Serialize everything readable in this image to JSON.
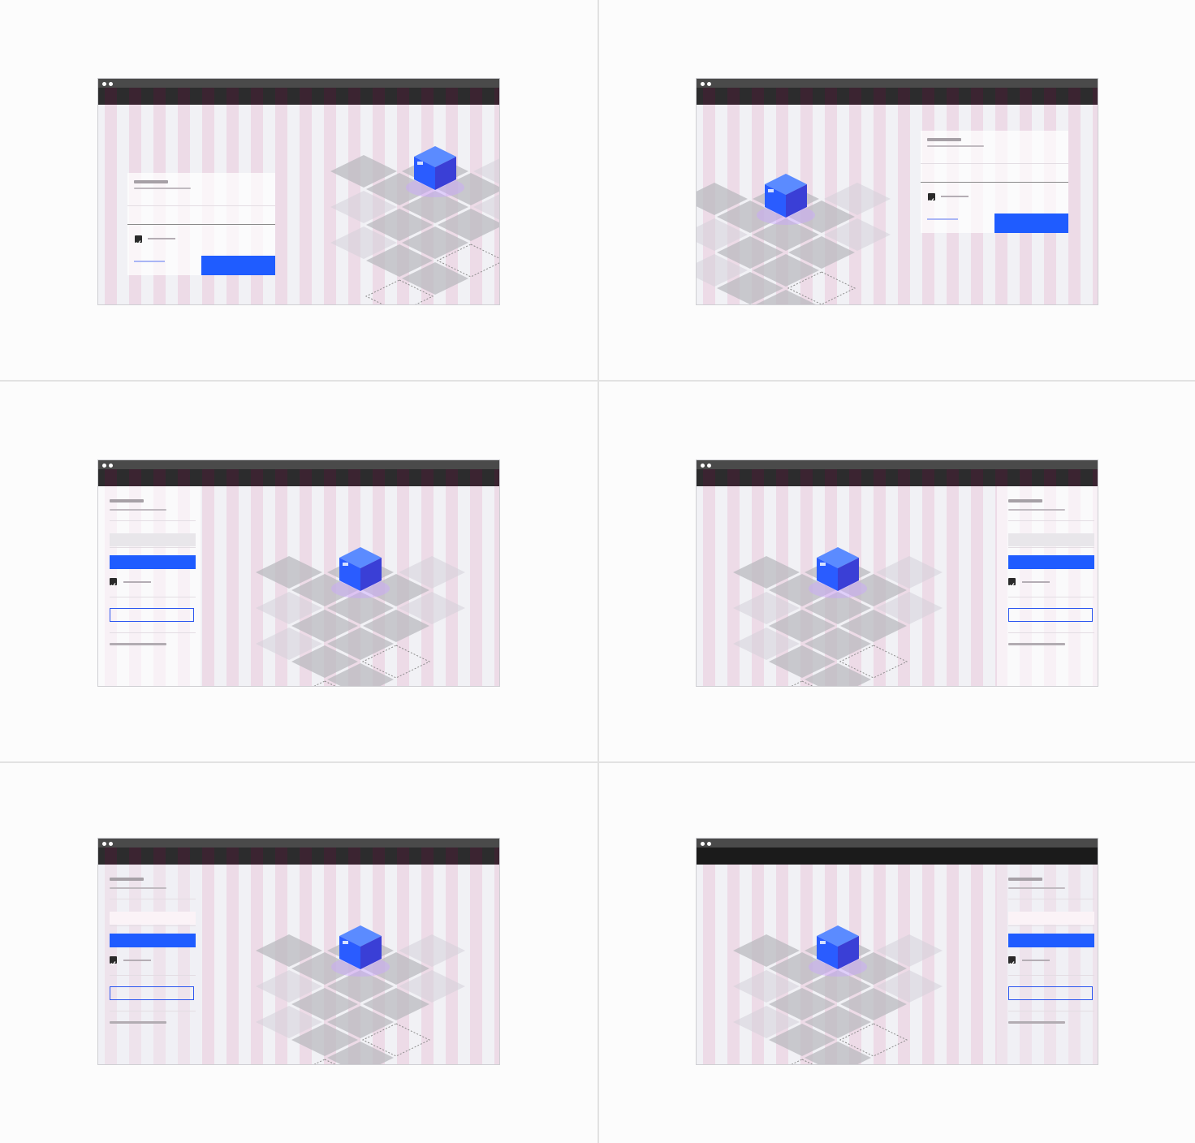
{
  "colors": {
    "page_background": "#fcfcfc",
    "divider": "#e2e2e2",
    "titlebar": "#4a4a4a",
    "header": "#1b1b1b",
    "panel_background": "#f1f1f5",
    "grid_column": "#e9c9db",
    "tile": "#b9b9bf",
    "cube": "#2f63ff",
    "primary_button": "#1f5cff",
    "outline_button": "#2c56f0",
    "link": "#a9b5f5",
    "checkbox": "#2a2a2a"
  },
  "icons": {
    "window_controls": "two-white-dots",
    "illustration": "isometric-blue-cube-on-tiles",
    "checkbox": "checkmark-icon"
  },
  "panels": [
    {
      "id": "card-left-illustration-right",
      "form_style": "card",
      "form_side": "left",
      "illustration_side": "right",
      "header_grid": true
    },
    {
      "id": "card-right-illustration-left",
      "form_style": "card",
      "form_side": "right",
      "illustration_side": "left",
      "header_grid": true
    },
    {
      "id": "sidebar-left-white",
      "form_style": "sidebar",
      "form_side": "left",
      "sidebar_tone": "white",
      "header_grid": true
    },
    {
      "id": "sidebar-right-white",
      "form_style": "sidebar",
      "form_side": "right",
      "sidebar_tone": "white",
      "header_grid": true
    },
    {
      "id": "sidebar-left-gray",
      "form_style": "sidebar",
      "form_side": "left",
      "sidebar_tone": "gray",
      "header_grid": true
    },
    {
      "id": "sidebar-right-gray",
      "form_style": "sidebar",
      "form_side": "right",
      "sidebar_tone": "gray",
      "header_grid": false
    }
  ]
}
